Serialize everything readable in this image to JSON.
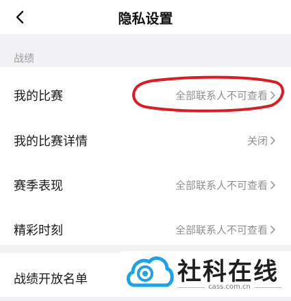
{
  "header": {
    "title": "隐私设置",
    "back_icon": "chevron-left-icon"
  },
  "section": {
    "label": "战绩"
  },
  "rows": [
    {
      "label": "我的比赛",
      "value": "全部联系人不可查看"
    },
    {
      "label": "我的比赛详情",
      "value": "关闭"
    },
    {
      "label": "赛季表现",
      "value": "全部联系人不可查看"
    },
    {
      "label": "精彩时刻",
      "value": "全部联系人不可查看"
    },
    {
      "label": "战绩开放名单",
      "value": ""
    }
  ],
  "annotation": {
    "color": "#e0191f",
    "shape": "hand-drawn-ellipse"
  },
  "watermark": {
    "title": "社科在线",
    "url": "cass.com.cn",
    "logo_color": "#1aa3e8"
  },
  "colors": {
    "page_bg": "#f2f2f4",
    "row_text": "#1a1a1a",
    "value_text": "#8f8f8f",
    "section_text": "#9b9b9b"
  }
}
